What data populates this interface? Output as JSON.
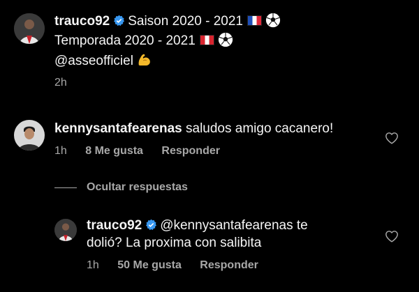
{
  "post": {
    "username": "trauco92",
    "lines": [
      "Saison 2020 - 2021",
      "Temporada 2020 - 2021",
      "@asseofficiel"
    ],
    "time": "2h"
  },
  "comment": {
    "username": "kennysantafearenas",
    "text": "saludos amigo cacanero!",
    "time": "1h",
    "likes": "8 Me gusta",
    "reply": "Responder"
  },
  "hide_replies": "Ocultar respuestas",
  "reply": {
    "username": "trauco92",
    "mention": "@kennysantafearenas",
    "text_line1_rest": "te",
    "text_line2": "dolió? La proxima con salibita",
    "time": "1h",
    "likes": "50 Me gusta",
    "reply": "Responder"
  },
  "icons": {
    "verified": "verified-badge-icon",
    "heart": "heart-icon",
    "flag_fr": "france-flag-icon",
    "flag_pe": "peru-flag-icon",
    "ball": "soccer-ball-icon",
    "muscle": "flexed-biceps-icon"
  },
  "colors": {
    "background": "#000000",
    "text": "#f5f5f5",
    "secondary": "#a8a8a8",
    "verified": "#3897f0"
  }
}
